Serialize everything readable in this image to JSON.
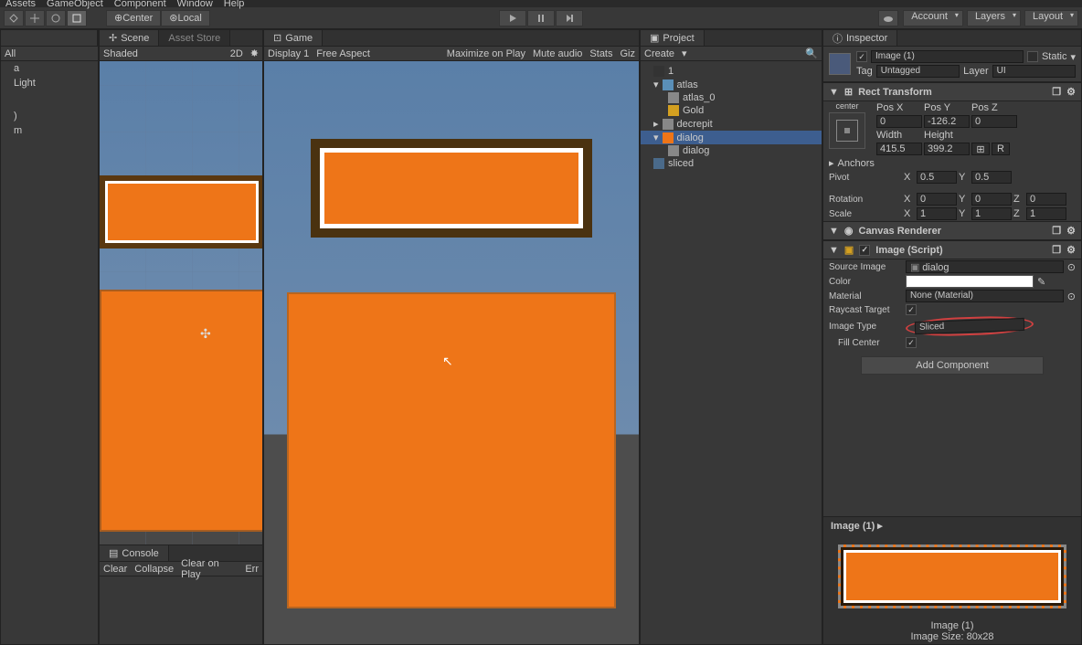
{
  "menubar": [
    "Assets",
    "GameObject",
    "Component",
    "Window",
    "Help"
  ],
  "toolbar": {
    "center": "Center",
    "local": "Local",
    "account": "Account",
    "layers": "Layers",
    "layout": "Layout"
  },
  "hierarchy": {
    "filter": "All",
    "items": [
      "a",
      "Light",
      ")",
      "m"
    ]
  },
  "scene": {
    "tab": "Scene",
    "tab2": "Asset Store",
    "shaded": "Shaded",
    "mode2d": "2D"
  },
  "game": {
    "tab": "Game",
    "display": "Display 1",
    "aspect": "Free Aspect",
    "maximize": "Maximize on Play",
    "mute": "Mute audio",
    "stats": "Stats",
    "giz": "Giz"
  },
  "console": {
    "tab": "Console",
    "clear": "Clear",
    "collapse": "Collapse",
    "clearplay": "Clear on Play",
    "err": "Err"
  },
  "project": {
    "tab": "Project",
    "create": "Create",
    "items": [
      {
        "name": "1",
        "icon": "unity",
        "indent": 1
      },
      {
        "name": "atlas",
        "icon": "atlas",
        "indent": 1
      },
      {
        "name": "atlas_0",
        "icon": "folder",
        "indent": 2
      },
      {
        "name": "Gold",
        "icon": "gold",
        "indent": 2
      },
      {
        "name": "decrepit",
        "icon": "folder",
        "indent": 1
      },
      {
        "name": "dialog",
        "icon": "orange",
        "indent": 1,
        "sel": true
      },
      {
        "name": "dialog",
        "icon": "folder",
        "indent": 2
      },
      {
        "name": "sliced",
        "icon": "cs",
        "indent": 1
      }
    ]
  },
  "inspector": {
    "tab": "Inspector",
    "name": "Image (1)",
    "static": "Static",
    "tag_label": "Tag",
    "tag": "Untagged",
    "layer_label": "Layer",
    "layer": "UI",
    "rect_transform": "Rect Transform",
    "anchor_preset": "center",
    "posx_label": "Pos X",
    "posx": "0",
    "posy_label": "Pos Y",
    "posy": "-126.2",
    "posz_label": "Pos Z",
    "posz": "0",
    "width_label": "Width",
    "width": "415.5",
    "height_label": "Height",
    "height": "399.2",
    "r_btn": "R",
    "anchors": "Anchors",
    "pivot": "Pivot",
    "pivot_x": "0.5",
    "pivot_y": "0.5",
    "rotation": "Rotation",
    "rot_x": "0",
    "rot_y": "0",
    "rot_z": "0",
    "scale": "Scale",
    "scale_x": "1",
    "scale_y": "1",
    "scale_z": "1",
    "canvas_renderer": "Canvas Renderer",
    "image_script": "Image (Script)",
    "source_image_label": "Source Image",
    "source_image": "dialog",
    "color_label": "Color",
    "material_label": "Material",
    "material": "None (Material)",
    "raycast_label": "Raycast Target",
    "image_type_label": "Image Type",
    "image_type": "Sliced",
    "fill_center_label": "Fill Center",
    "add_component": "Add Component",
    "preview_name": "Image (1)",
    "preview_footer1": "Image (1)",
    "preview_footer2": "Image Size: 80x28"
  }
}
